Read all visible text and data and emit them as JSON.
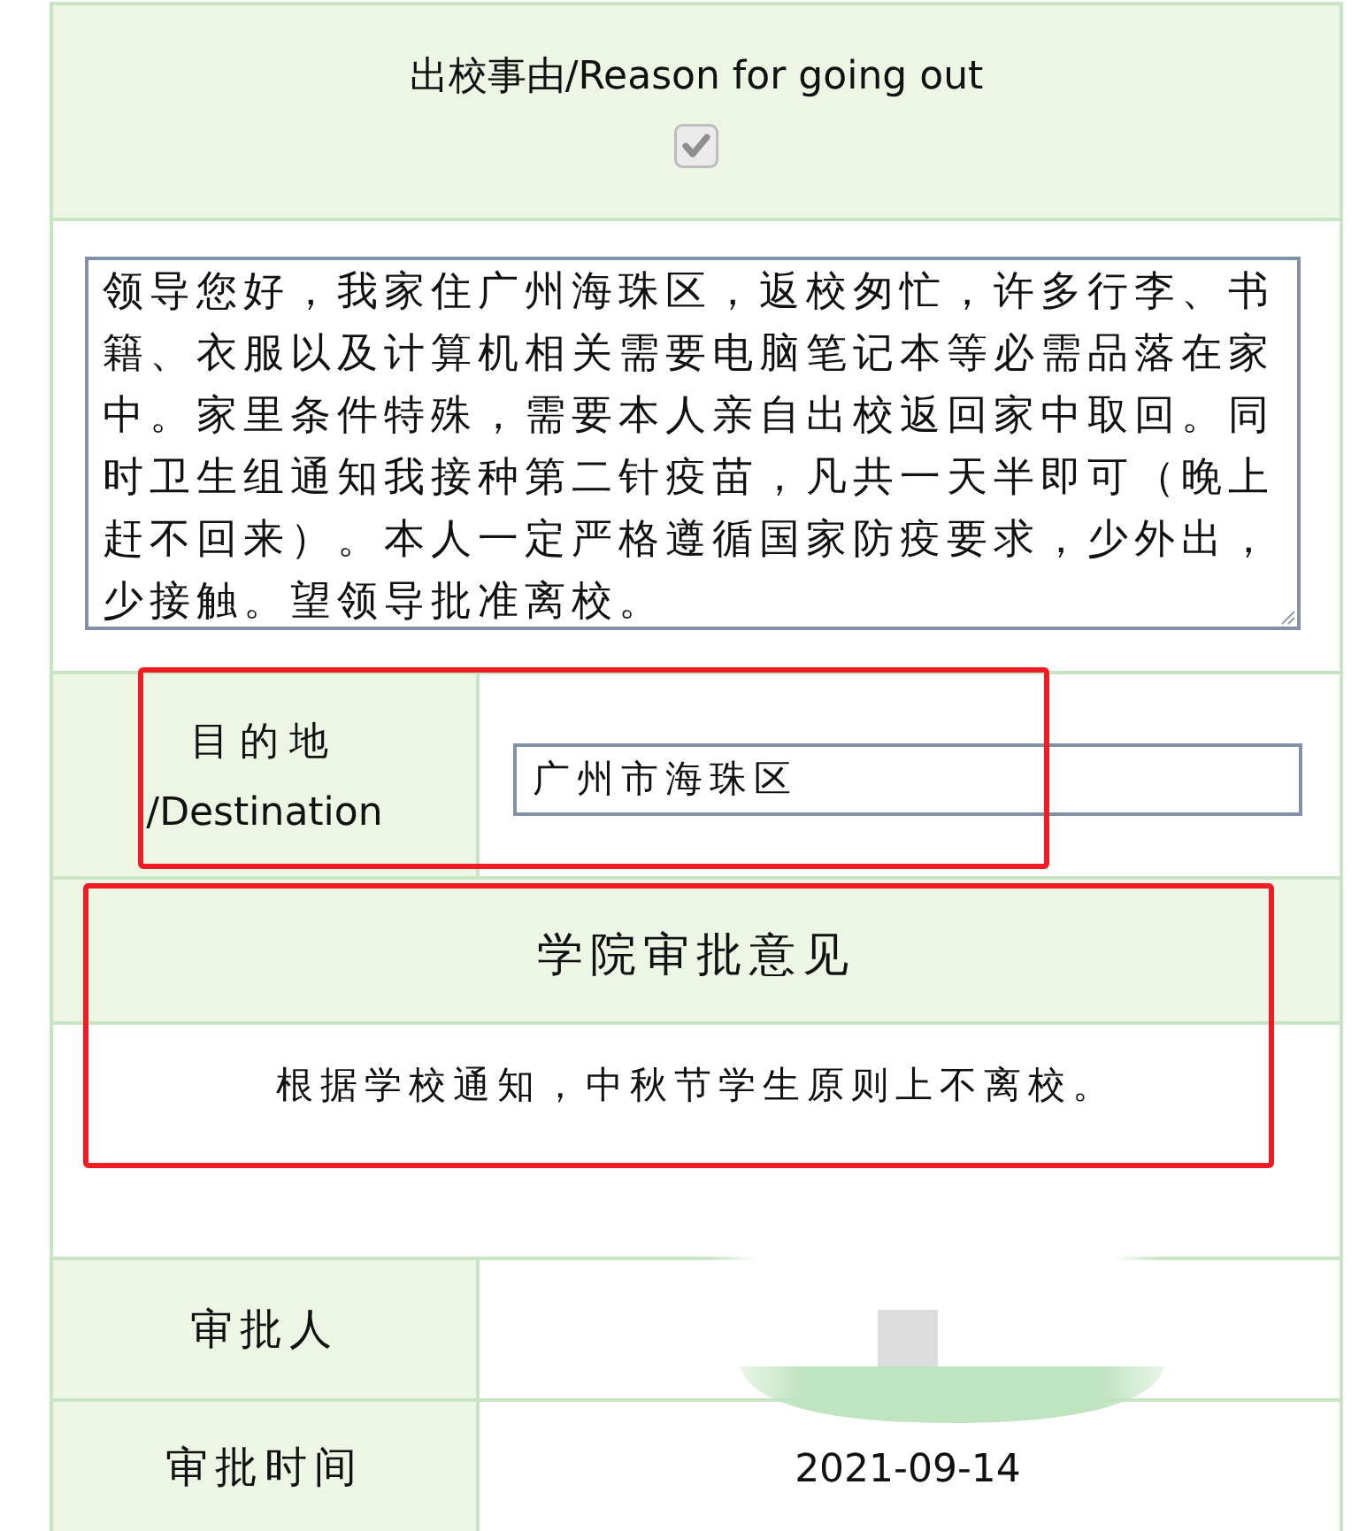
{
  "reason": {
    "title": "出校事由/Reason for going out",
    "checkbox": {
      "checked": true,
      "disabled": true
    },
    "text": "领导您好，我家住广州海珠区，返校匆忙，许多行李、书籍、衣服以及计算机相关需要电脑笔记本等必需品落在家中。家里条件特殊，需要本人亲自出校返回家中取回。同时卫生组通知我接种第二针疫苗，凡共一天半即可（晚上赶不回来）。本人一定严格遵循国家防疫要求，少外出，少接触。望领导批准离校。"
  },
  "destination": {
    "label_lines": [
      "目的地",
      "/Destination"
    ],
    "value": "广州市海珠区",
    "highlighted": true
  },
  "approval": {
    "title": "学院审批意见",
    "comment": "根据学校通知，中秋节学生原则上不离校。",
    "highlighted": true
  },
  "details": [
    {
      "label": "审批人",
      "redacted": true
    },
    {
      "label": "审批时间",
      "value": "2021-09-14",
      "redacted": false
    }
  ]
}
